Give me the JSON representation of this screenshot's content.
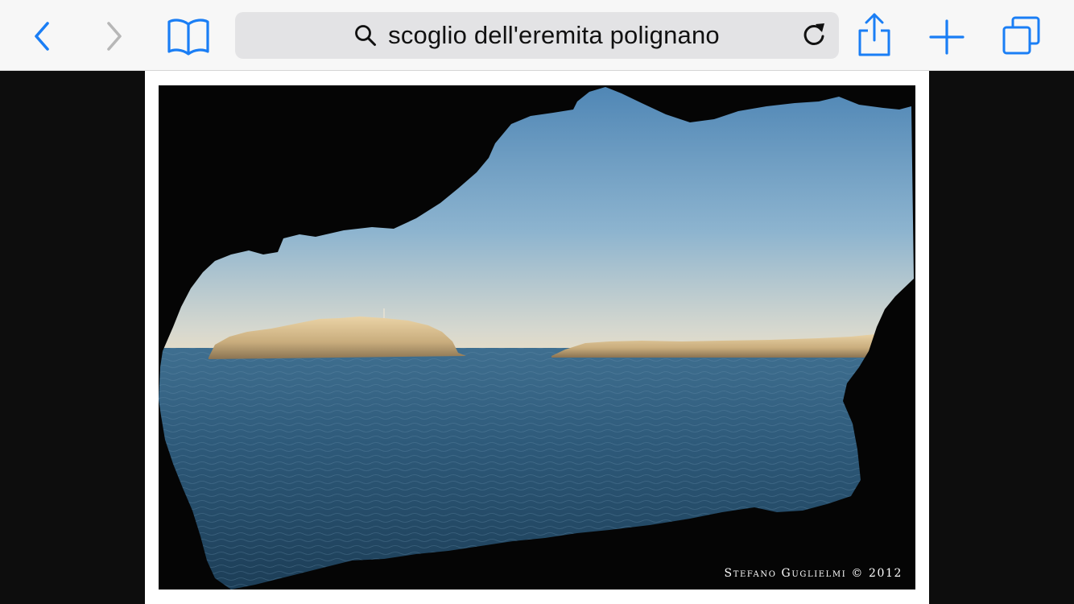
{
  "toolbar": {
    "address_text": "scoglio dell'eremita polignano",
    "icons": {
      "back": "chevron-left-icon",
      "forward": "chevron-right-icon",
      "bookmarks": "open-book-icon",
      "search": "magnifier-icon",
      "reload": "reload-icon",
      "share": "share-icon",
      "add": "plus-icon",
      "tabs": "tabs-icon"
    },
    "accent_color": "#1a7ef5",
    "disabled_color": "#b7b7b7"
  },
  "photo": {
    "watermark": "Stefano Guglielmi © 2012"
  }
}
